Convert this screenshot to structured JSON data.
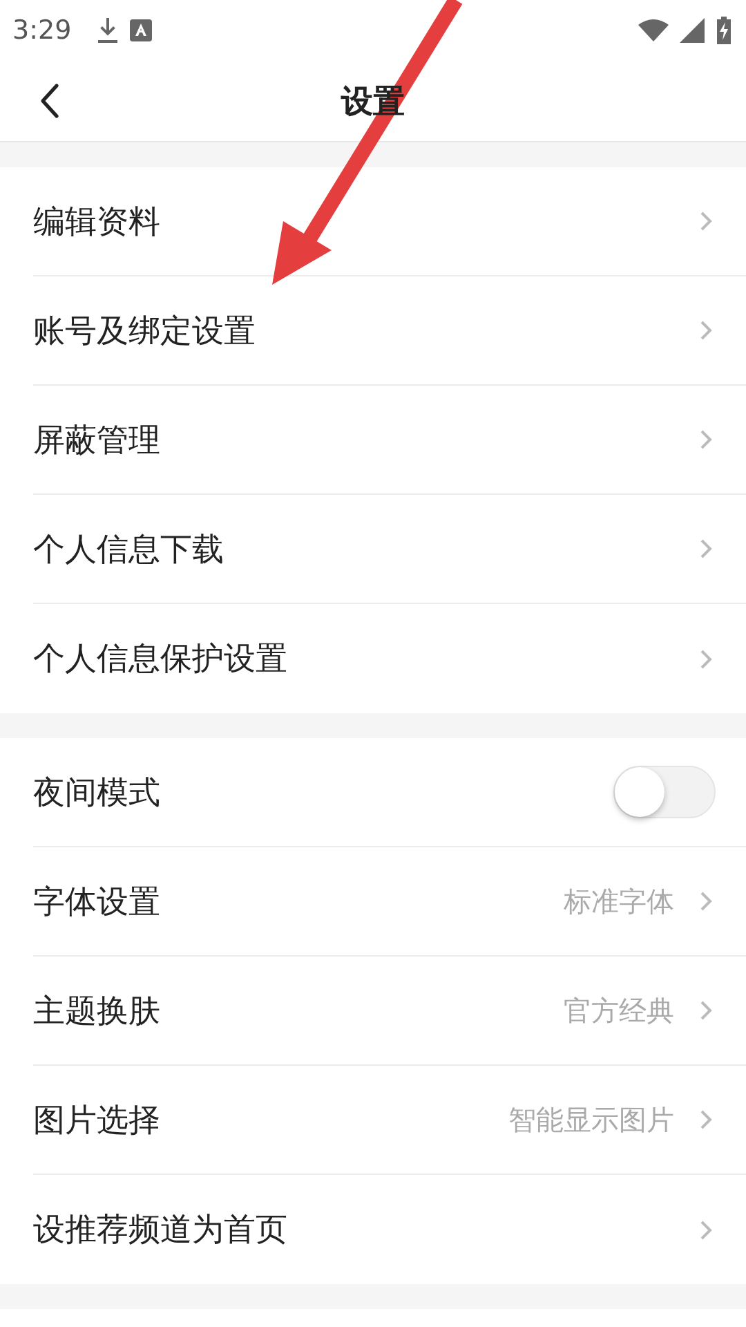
{
  "status_bar": {
    "time": "3:29"
  },
  "header": {
    "title": "设置"
  },
  "sections": [
    {
      "items": [
        {
          "kind": "link",
          "label": "编辑资料"
        },
        {
          "kind": "link",
          "label": "账号及绑定设置"
        },
        {
          "kind": "link",
          "label": "屏蔽管理"
        },
        {
          "kind": "link",
          "label": "个人信息下载"
        },
        {
          "kind": "link",
          "label": "个人信息保护设置"
        }
      ]
    },
    {
      "items": [
        {
          "kind": "toggle",
          "label": "夜间模式",
          "on": false
        },
        {
          "kind": "link",
          "label": "字体设置",
          "value": "标准字体"
        },
        {
          "kind": "link",
          "label": "主题换肤",
          "value": "官方经典"
        },
        {
          "kind": "link",
          "label": "图片选择",
          "value": "智能显示图片"
        },
        {
          "kind": "link",
          "label": "设推荐频道为首页"
        }
      ]
    }
  ]
}
